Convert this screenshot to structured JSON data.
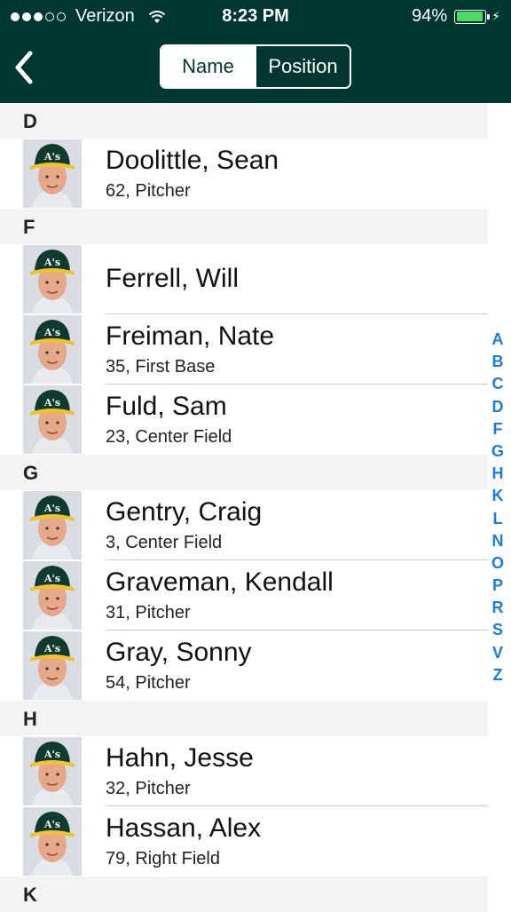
{
  "status_bar": {
    "carrier": "Verizon",
    "time": "8:23 PM",
    "battery": "94%",
    "battery_level": 0.94,
    "signal_bars": 3
  },
  "nav": {
    "back_icon": "chevron-left-icon",
    "segments": [
      "Name",
      "Position"
    ],
    "selected_segment": "Name"
  },
  "colors": {
    "nav_background": "#003831",
    "accent_blue": "#1a7de0",
    "battery_green": "#4cd964"
  },
  "sections": [
    {
      "letter": "D",
      "players": [
        {
          "name": "Doolittle, Sean",
          "detail": "62, Pitcher"
        }
      ]
    },
    {
      "letter": "F",
      "players": [
        {
          "name": "Ferrell, Will",
          "detail": ""
        },
        {
          "name": "Freiman, Nate",
          "detail": "35, First Base"
        },
        {
          "name": "Fuld, Sam",
          "detail": "23, Center Field"
        }
      ]
    },
    {
      "letter": "G",
      "players": [
        {
          "name": "Gentry, Craig",
          "detail": "3, Center Field"
        },
        {
          "name": "Graveman, Kendall",
          "detail": "31, Pitcher"
        },
        {
          "name": "Gray, Sonny",
          "detail": "54, Pitcher"
        }
      ]
    },
    {
      "letter": "H",
      "players": [
        {
          "name": "Hahn, Jesse",
          "detail": "32, Pitcher"
        },
        {
          "name": "Hassan, Alex",
          "detail": "79, Right Field"
        }
      ]
    },
    {
      "letter": "K",
      "players": []
    }
  ],
  "index_letters": [
    "A",
    "B",
    "C",
    "D",
    "F",
    "G",
    "H",
    "K",
    "L",
    "N",
    "O",
    "P",
    "R",
    "S",
    "V",
    "Z"
  ]
}
